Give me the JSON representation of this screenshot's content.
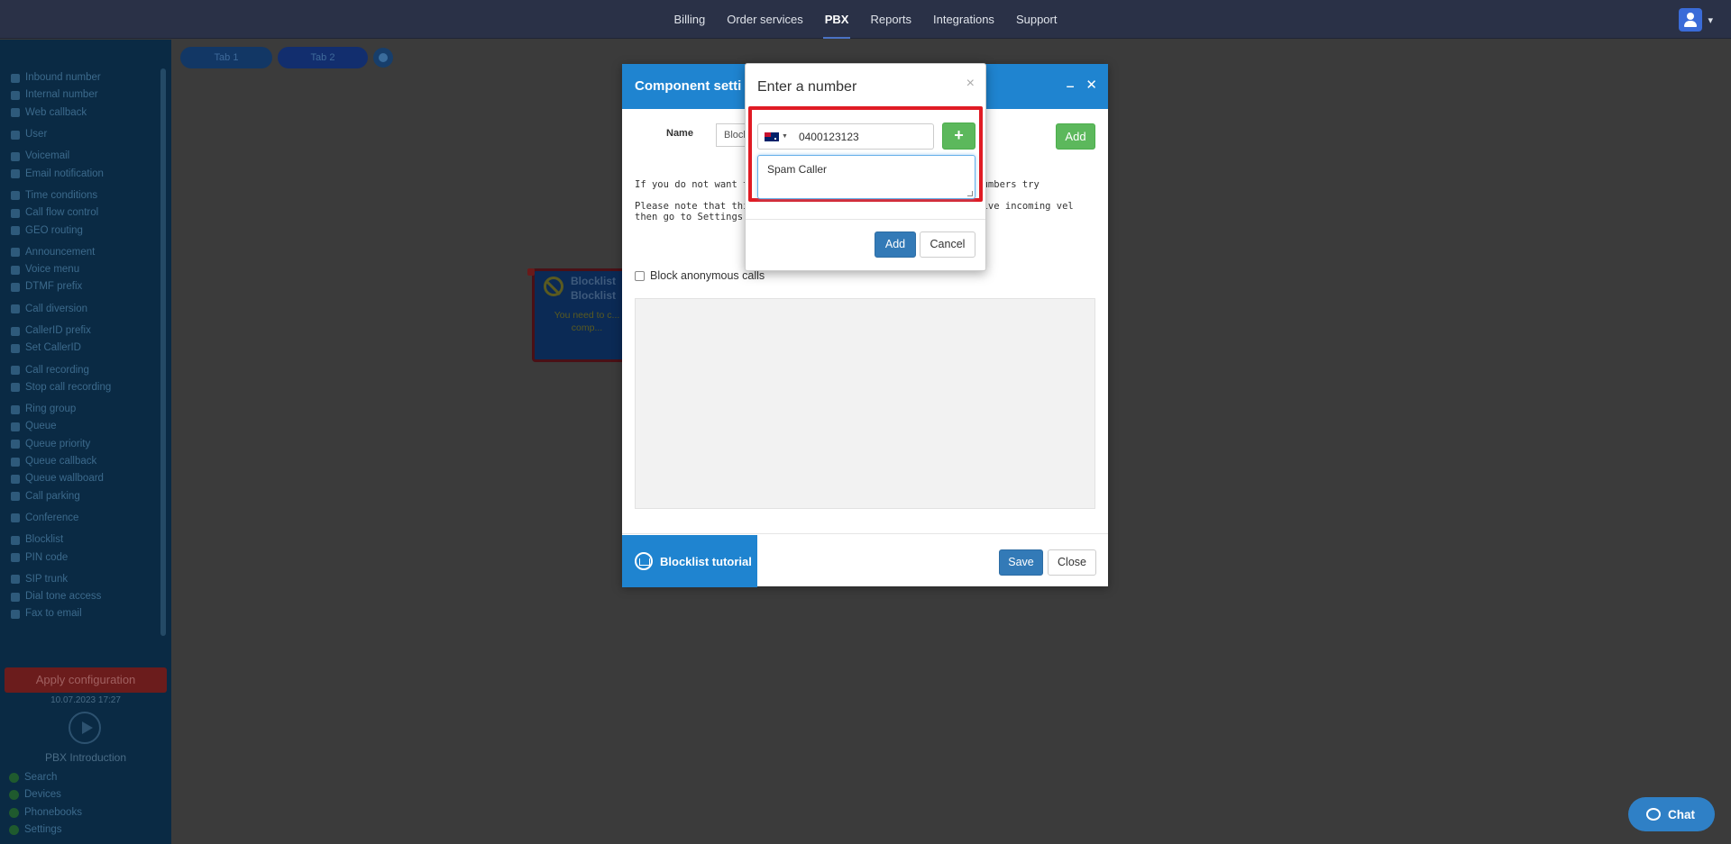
{
  "topnav": {
    "items": [
      "Billing",
      "Order services",
      "PBX",
      "Reports",
      "Integrations",
      "Support"
    ],
    "active_index": 2
  },
  "sidebar": {
    "groups": [
      [
        "Inbound number",
        "Internal number",
        "Web callback"
      ],
      [
        "User"
      ],
      [
        "Voicemail",
        "Email notification"
      ],
      [
        "Time conditions",
        "Call flow control",
        "GEO routing"
      ],
      [
        "Announcement",
        "Voice menu",
        "DTMF prefix"
      ],
      [
        "Call diversion"
      ],
      [
        "CallerID prefix",
        "Set CallerID"
      ],
      [
        "Call recording",
        "Stop call recording"
      ],
      [
        "Ring group",
        "Queue",
        "Queue priority",
        "Queue callback",
        "Queue wallboard",
        "Call parking"
      ],
      [
        "Conference"
      ],
      [
        "Blocklist",
        "PIN code"
      ],
      [
        "SIP trunk",
        "Dial tone access",
        "Fax to email"
      ]
    ],
    "apply_label": "Apply configuration",
    "date": "10.07.2023 17:27",
    "intro_label": "PBX Introduction",
    "bottom_items": [
      "Search",
      "Devices",
      "Phonebooks",
      "Settings"
    ]
  },
  "tabs": [
    "Tab 1",
    "Tab 2"
  ],
  "node": {
    "title1": "Blocklist",
    "title2": "Blocklist",
    "warning": "You need to c... comp..."
  },
  "component_modal": {
    "title": "Component setti",
    "name_label": "Name",
    "name_value": "Block",
    "add_label": "Add",
    "desc1": "If you do not want to rec                                                    them to the blocklist. When these numbers try",
    "desc2": "Please note that this is a                                                     enario. If you do not want to receive incoming                                                    vel then go to Settings > Global blocklist.",
    "checkbox_label": "Block anonymous calls",
    "tutorial_label": "Blocklist tutorial",
    "save_label": "Save",
    "close_label": "Close"
  },
  "number_modal": {
    "title": "Enter a number",
    "close_glyph": "×",
    "country": "AU",
    "phone_value": "0400123123",
    "plus_glyph": "+",
    "note_value": "Spam Caller",
    "add_label": "Add",
    "cancel_label": "Cancel"
  },
  "chat": {
    "label": "Chat"
  },
  "colors": {
    "nav_bg": "#2a3147",
    "modal_header": "#1f84d0",
    "primary_btn": "#337ab7",
    "success_btn": "#5cb85c",
    "highlight": "#e01b24"
  }
}
